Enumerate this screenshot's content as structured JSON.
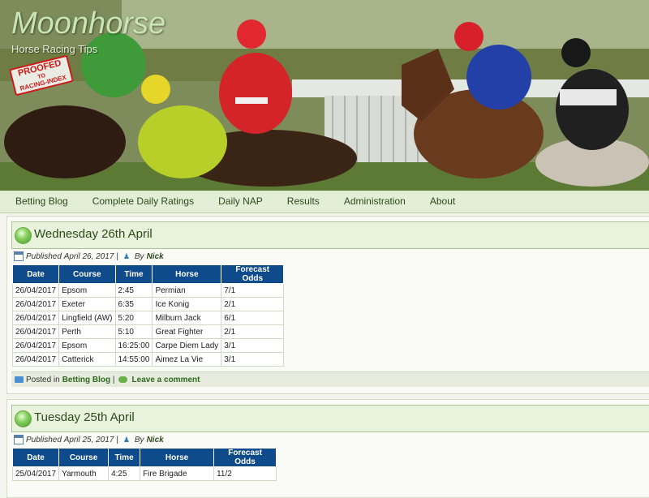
{
  "site": {
    "title": "Moonhorse",
    "tagline": "Horse Racing Tips",
    "stamp_line1": "PROOFED",
    "stamp_line2": "TO",
    "stamp_line3": "RACING-INDEX"
  },
  "nav": {
    "items": [
      {
        "label": "Betting Blog"
      },
      {
        "label": "Complete Daily Ratings"
      },
      {
        "label": "Daily NAP"
      },
      {
        "label": "Results"
      },
      {
        "label": "Administration"
      },
      {
        "label": "About"
      }
    ]
  },
  "posts": [
    {
      "title": "Wednesday 26th April",
      "published_prefix": "Published",
      "published_date": "April 26, 2017",
      "by_prefix": "By",
      "author": "Nick",
      "table": {
        "headers": [
          "Date",
          "Course",
          "Time",
          "Horse",
          "Forecast Odds"
        ],
        "rows": [
          [
            "26/04/2017",
            "Epsom",
            "2:45",
            "Permian",
            "7/1"
          ],
          [
            "26/04/2017",
            "Exeter",
            "6:35",
            "Ice Konig",
            "2/1"
          ],
          [
            "26/04/2017",
            "Lingfield (AW)",
            "5:20",
            "Milburn Jack",
            "6/1"
          ],
          [
            "26/04/2017",
            "Perth",
            "5:10",
            "Great Fighter",
            "2/1"
          ],
          [
            "26/04/2017",
            "Epsom",
            "16:25:00",
            "Carpe Diem Lady",
            "3/1"
          ],
          [
            "26/04/2017",
            "Catterick",
            "14:55:00",
            "Aimez La Vie",
            "3/1"
          ]
        ]
      },
      "footer": {
        "posted_in": "Posted in",
        "category": "Betting Blog",
        "comment": "Leave a comment"
      }
    },
    {
      "title": "Tuesday 25th April",
      "published_prefix": "Published",
      "published_date": "April 25, 2017",
      "by_prefix": "By",
      "author": "Nick",
      "table": {
        "headers": [
          "Date",
          "Course",
          "Time",
          "Horse",
          "Forecast Odds"
        ],
        "rows": [
          [
            "25/04/2017",
            "Yarmouth",
            "4:25",
            "Fire Brigade",
            "11/2"
          ]
        ]
      }
    }
  ]
}
